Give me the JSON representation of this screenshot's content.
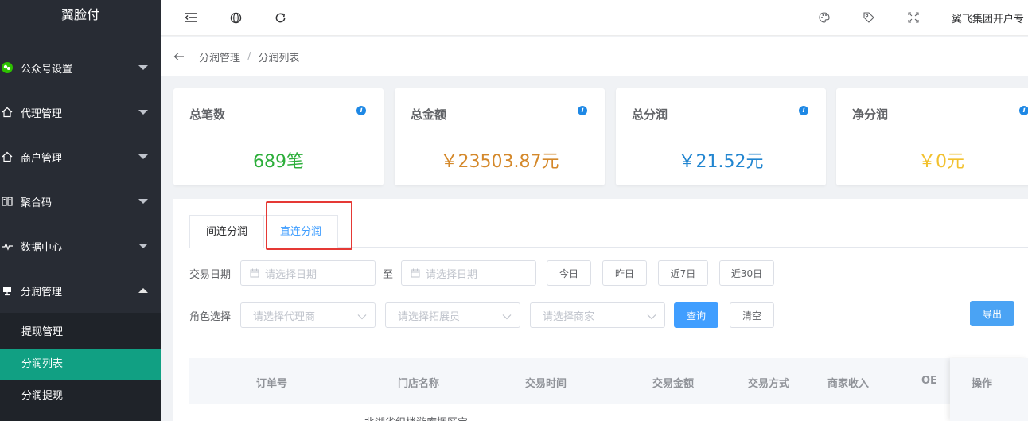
{
  "app": {
    "logo": "翼脸付"
  },
  "sidebar": {
    "items": [
      {
        "label": "公众号设置",
        "icon": "wechat-icon"
      },
      {
        "label": "代理管理",
        "icon": "home-icon"
      },
      {
        "label": "商户管理",
        "icon": "home-icon"
      },
      {
        "label": "聚合码",
        "icon": "book-icon"
      },
      {
        "label": "数据中心",
        "icon": "pulse-icon"
      },
      {
        "label": "分润管理",
        "icon": "board-icon"
      }
    ],
    "submenu": [
      {
        "label": "提现管理"
      },
      {
        "label": "分润列表"
      },
      {
        "label": "分润提现"
      }
    ]
  },
  "topbar": {
    "user": "翼飞集团开户专"
  },
  "breadcrumb": {
    "items": [
      "分润管理",
      "分润列表"
    ]
  },
  "cards": [
    {
      "title": "总笔数",
      "value": "689笔",
      "color": "#2cae3a"
    },
    {
      "title": "总金额",
      "value": "￥23503.87元",
      "color": "#d4882a"
    },
    {
      "title": "总分润",
      "value": "￥21.52元",
      "color": "#2185d0"
    },
    {
      "title": "净分润",
      "value": "￥0元",
      "color": "#f2c12e"
    }
  ],
  "tabs": [
    {
      "label": "间连分润"
    },
    {
      "label": "直连分润"
    }
  ],
  "filters": {
    "date_label": "交易日期",
    "date_start_placeholder": "请选择日期",
    "date_sep": "至",
    "date_end_placeholder": "请选择日期",
    "quick": [
      "今日",
      "昨日",
      "近7日",
      "近30日"
    ],
    "role_label": "角色选择",
    "agent_placeholder": "请选择代理商",
    "expander_placeholder": "请选择拓展员",
    "merchant_placeholder": "请选择商家",
    "query": "查询",
    "clear": "清空",
    "export": "导出"
  },
  "table": {
    "headers": [
      "订单号",
      "门店名称",
      "交易时间",
      "交易金额",
      "交易方式",
      "商家收入",
      "OE",
      "操作"
    ],
    "first_row_partial": "北湖省织楼游庵捆区宝"
  }
}
